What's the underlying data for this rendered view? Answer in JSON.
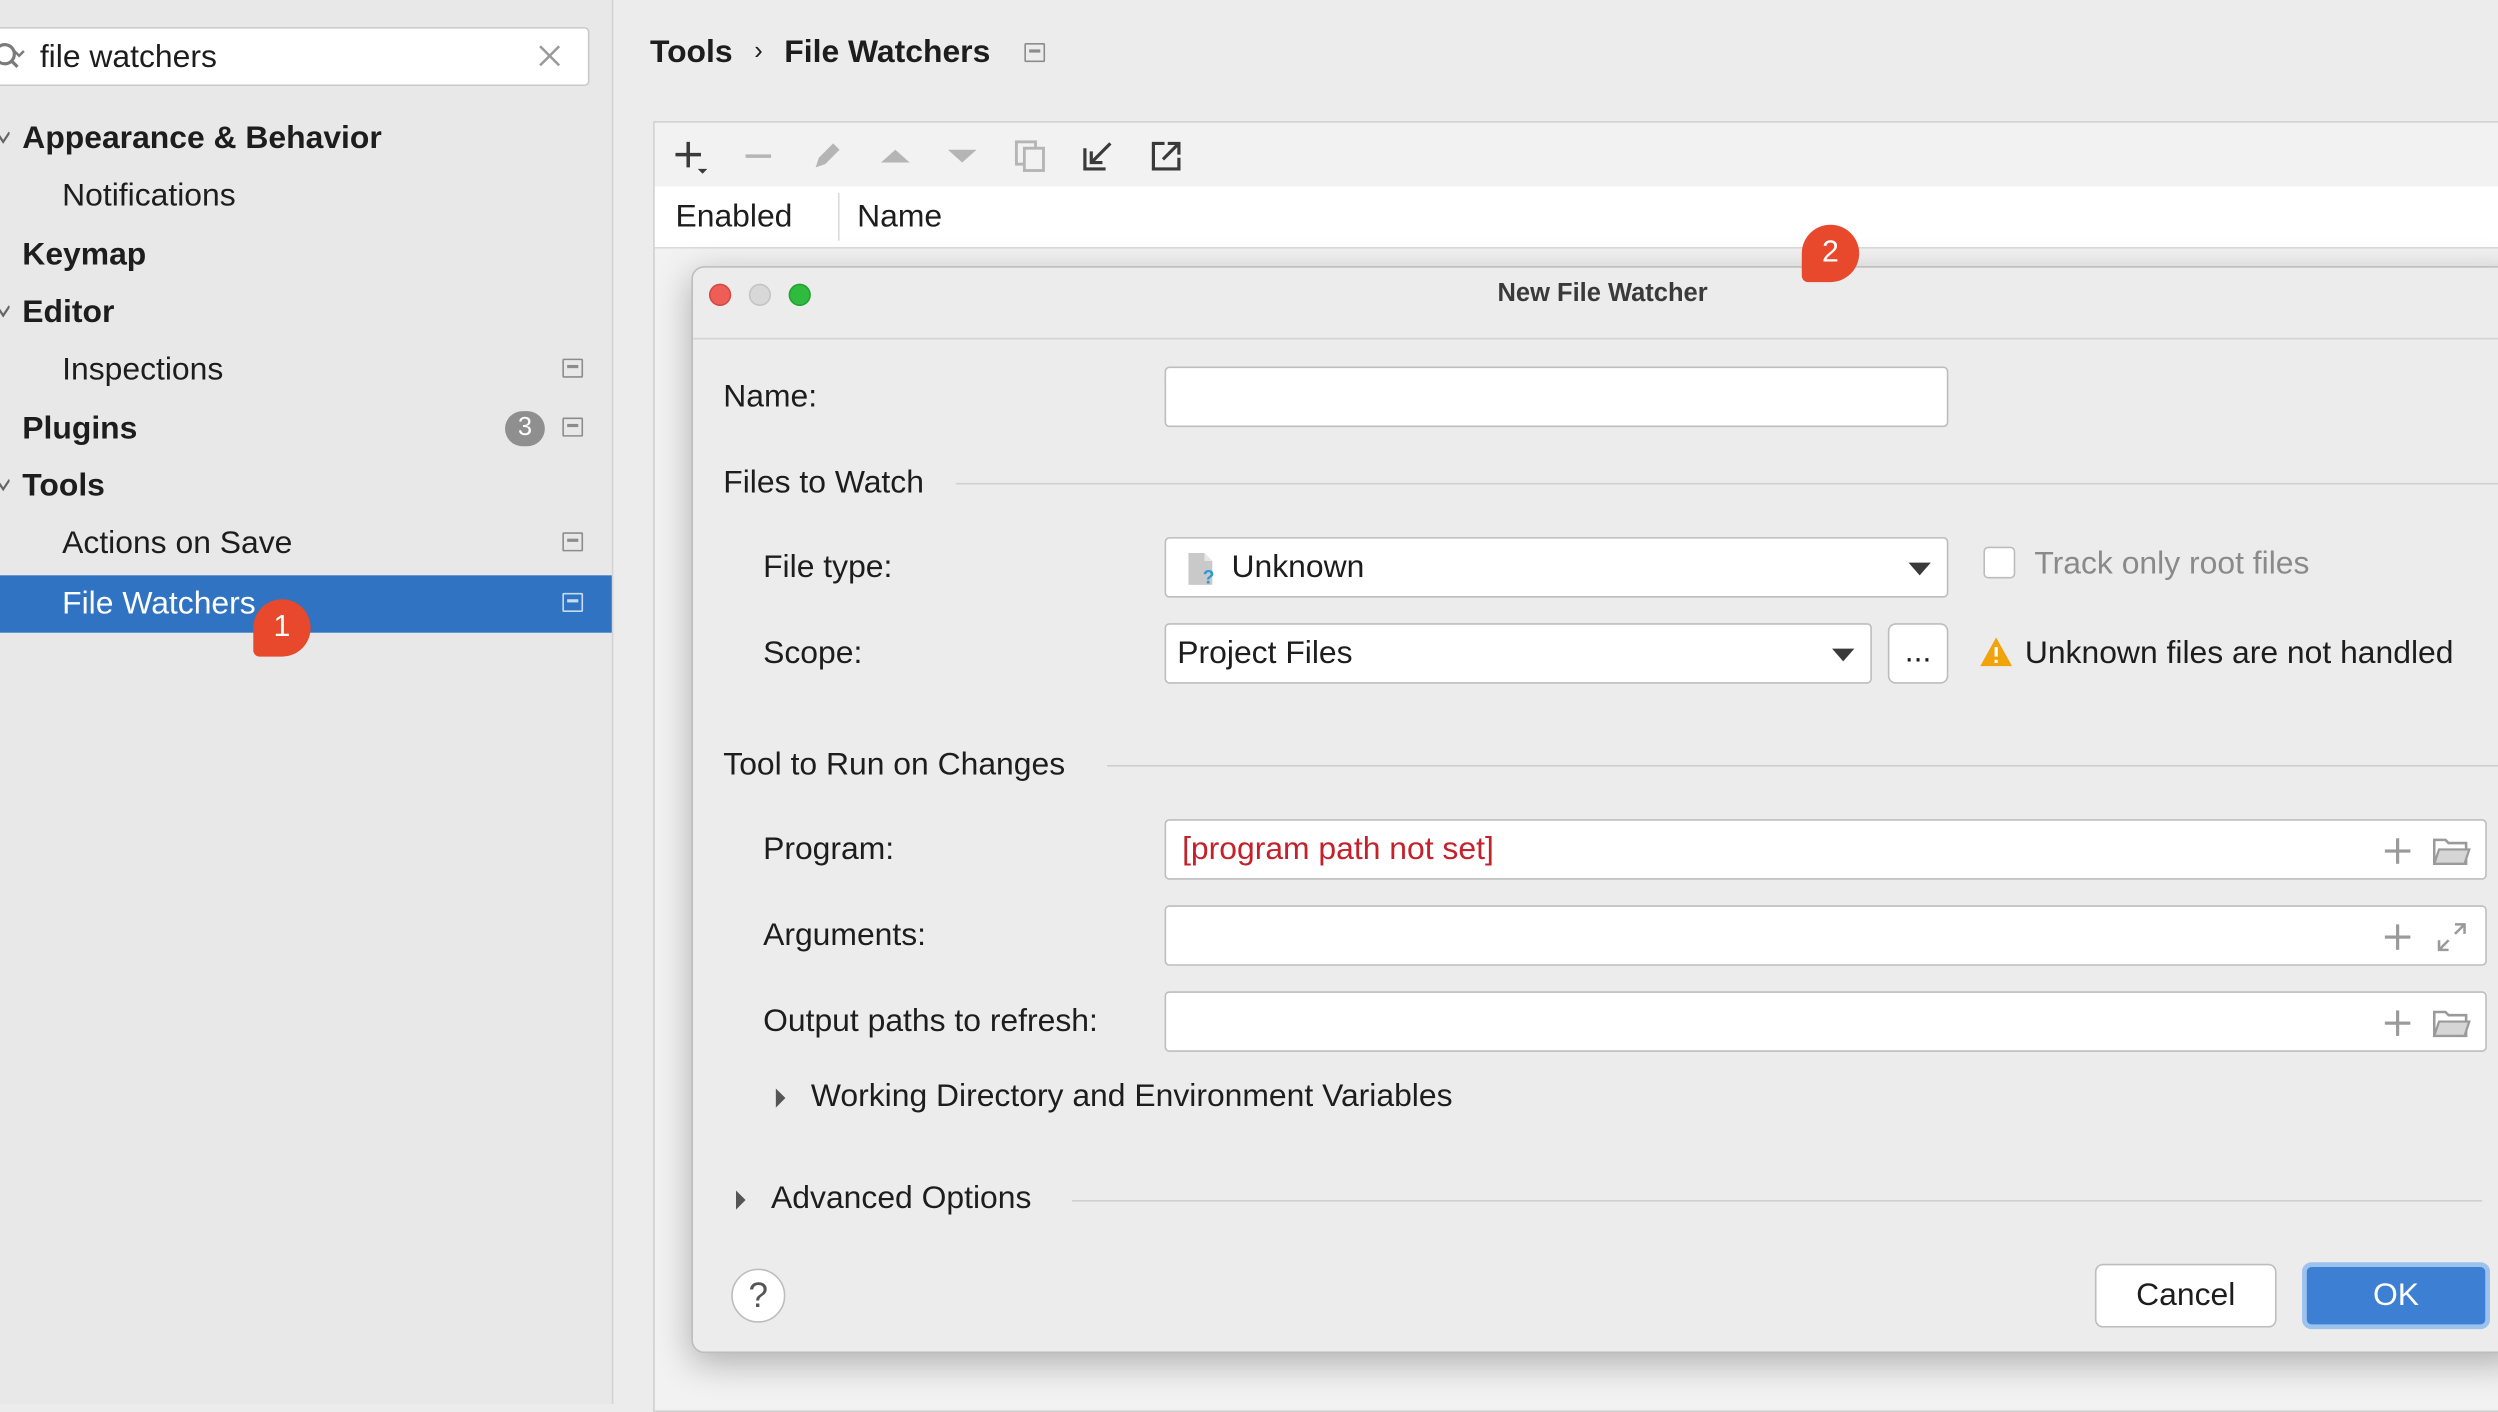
{
  "search": {
    "value": "file watchers"
  },
  "sidebar": {
    "items": [
      {
        "label": "Appearance & Behavior"
      },
      {
        "label": "Notifications"
      },
      {
        "label": "Keymap"
      },
      {
        "label": "Editor"
      },
      {
        "label": "Inspections"
      },
      {
        "label": "Plugins",
        "badge": "3"
      },
      {
        "label": "Tools"
      },
      {
        "label": "Actions on Save"
      },
      {
        "label": "File Watchers"
      }
    ]
  },
  "callouts": {
    "one": "1",
    "two": "2"
  },
  "breadcrumb": {
    "parent": "Tools",
    "separator": "›",
    "current": "File Watchers"
  },
  "table": {
    "col_enabled": "Enabled",
    "col_name": "Name"
  },
  "dialog": {
    "title": "New File Watcher",
    "name_label": "Name:",
    "name_value": "",
    "files_section": "Files to Watch",
    "file_type_label": "File type:",
    "file_type_value": "Unknown",
    "track_root_label": "Track only root files",
    "track_root_checked": false,
    "scope_label": "Scope:",
    "scope_value": "Project Files",
    "scope_more": "...",
    "warning_text": "Unknown files are not handled",
    "tool_section": "Tool to Run on Changes",
    "program_label": "Program:",
    "program_value": "[program path not set]",
    "arguments_label": "Arguments:",
    "arguments_value": "",
    "output_label": "Output paths to refresh:",
    "output_value": "",
    "working_dir_label": "Working Directory and Environment Variables",
    "advanced_label": "Advanced Options",
    "help_label": "?",
    "cancel_label": "Cancel",
    "ok_label": "OK"
  },
  "colors": {
    "selection": "#2f73c2",
    "error_text": "#c4212b",
    "callout": "#e8482c",
    "ok_button": "#3d7fd2",
    "warning": "#f0a30a"
  }
}
